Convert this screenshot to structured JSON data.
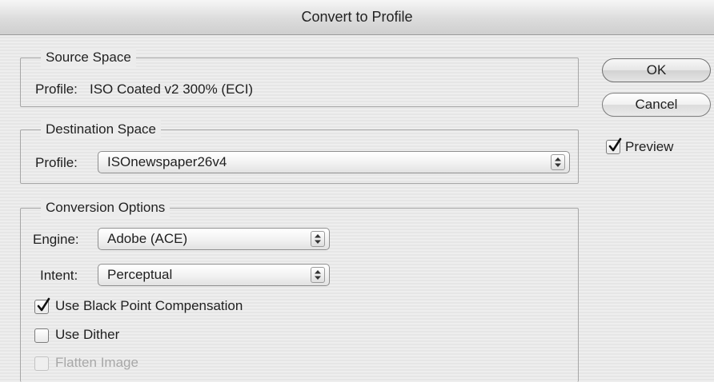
{
  "dialog": {
    "title": "Convert to Profile"
  },
  "source_space": {
    "legend": "Source Space",
    "profile_label": "Profile:",
    "profile_value": "ISO Coated v2 300% (ECI)"
  },
  "destination_space": {
    "legend": "Destination Space",
    "profile_label": "Profile:",
    "profile_selected": "ISOnewspaper26v4"
  },
  "conversion_options": {
    "legend": "Conversion Options",
    "engine_label": "Engine:",
    "engine_selected": "Adobe (ACE)",
    "intent_label": "Intent:",
    "intent_selected": "Perceptual",
    "black_point_label": "Use Black Point Compensation",
    "black_point_checked": true,
    "dither_label": "Use Dither",
    "dither_checked": false,
    "flatten_label": "Flatten Image",
    "flatten_checked": false,
    "flatten_enabled": false
  },
  "buttons": {
    "ok_label": "OK",
    "cancel_label": "Cancel"
  },
  "preview": {
    "label": "Preview",
    "checked": true
  },
  "icons": {
    "checkmark": "checkmark-icon",
    "popup_arrows": "up-down-arrows-icon"
  }
}
